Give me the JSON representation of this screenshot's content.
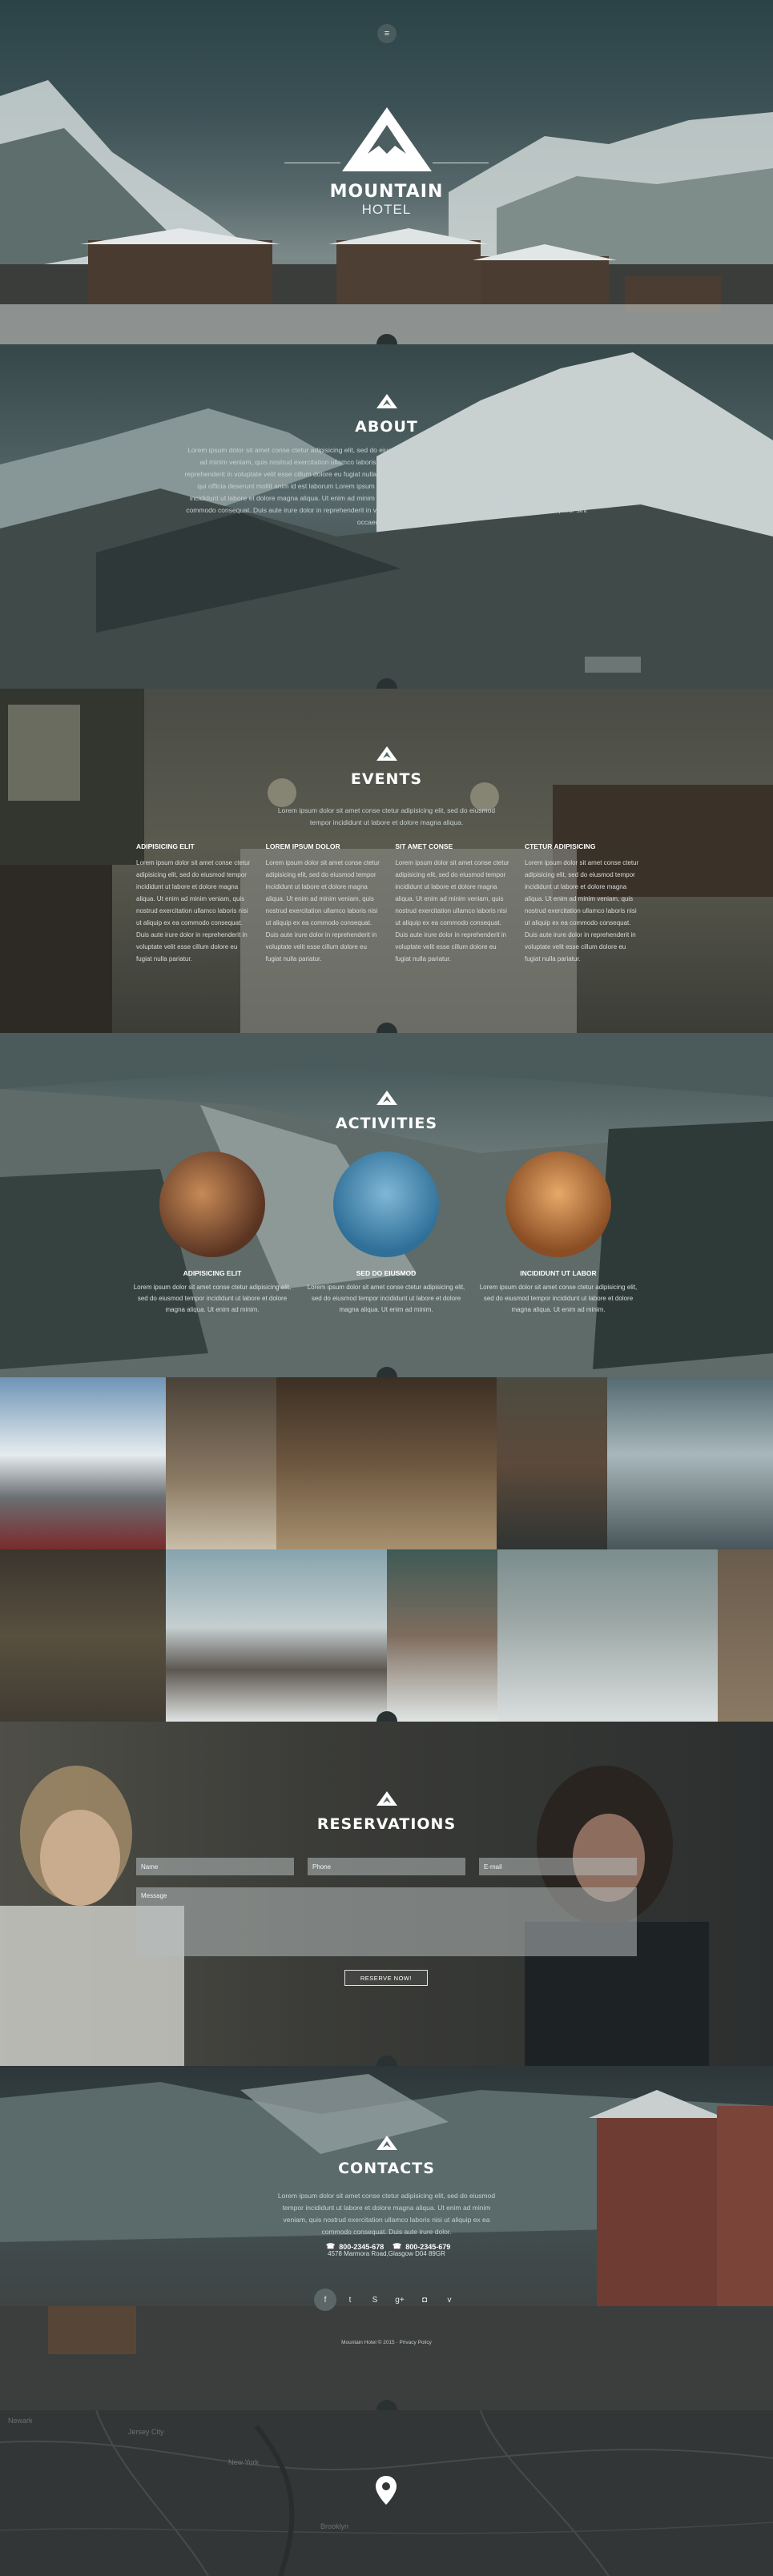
{
  "hero": {
    "title": "MOUNTAIN",
    "subtitle": "HOTEL",
    "menu_icon": "hamburger-icon"
  },
  "about": {
    "title": "ABOUT",
    "text": "Lorem ipsum dolor sit amet conse ctetur adipisicing elit, sed do eiusmod tempor incididunt ut labore et dolore magna aliqua. Ut enim ad minim veniam, quis nostrud exercitation ullamco laboris nisi ut aliquip ex ea commodo consequat. Duis aute irure dolor in reprehenderit in voluptate velit esse cillum dolore eu fugiat nulla pariatur. Excepteur sint occaecat cupidatat non proident, sunt in culpa qui officia deserunt mollit anim id est laborum Lorem ipsum dolor sit amet conse ctetur adipisicing elit, sed do eiusmod tempor incididunt ut labore et dolore magna aliqua. Ut enim ad minim veniam, quis nostrud exercitation ullamco laboris nisi ut aliquip ex ea commodo consequat. Duis aute irure dolor in reprehenderit in voluptate velit esse cillum dolore eu fugiat nulla pariatur. Excepteur sint occaecat cupidatat."
  },
  "events": {
    "title": "EVENTS",
    "intro": "Lorem ipsum dolor sit amet conse ctetur adipisicing elit, sed do eiusmod tempor incididunt ut labore et dolore magna aliqua.",
    "columns": [
      {
        "heading": "ADIPISICING ELIT",
        "text": "Lorem ipsum dolor sit amet conse ctetur adipisicing elit, sed do eiusmod tempor incididunt ut labore et dolore magna aliqua. Ut enim ad minim veniam, quis nostrud exercitation ullamco laboris nisi ut aliquip ex ea commodo consequat. Duis aute irure dolor in reprehenderit in voluptate velit esse cillum dolore eu fugiat nulla pariatur."
      },
      {
        "heading": "LOREM IPSUM DOLOR",
        "text": "Lorem ipsum dolor sit amet conse ctetur adipisicing elit, sed do eiusmod tempor incididunt ut labore et dolore magna aliqua. Ut enim ad minim veniam, quis nostrud exercitation ullamco laboris nisi ut aliquip ex ea commodo consequat. Duis aute irure dolor in reprehenderit in voluptate velit esse cillum dolore eu fugiat nulla pariatur."
      },
      {
        "heading": "SIT AMET CONSE",
        "text": "Lorem ipsum dolor sit amet conse ctetur adipisicing elit, sed do eiusmod tempor incididunt ut labore et dolore magna aliqua. Ut enim ad minim veniam, quis nostrud exercitation ullamco laboris nisi ut aliquip ex ea commodo consequat. Duis aute irure dolor in reprehenderit in voluptate velit esse cillum dolore eu fugiat nulla pariatur."
      },
      {
        "heading": "CTETUR ADIPISICING",
        "text": "Lorem ipsum dolor sit amet conse ctetur adipisicing elit, sed do eiusmod tempor incididunt ut labore et dolore magna aliqua. Ut enim ad minim veniam, quis nostrud exercitation ullamco laboris nisi ut aliquip ex ea commodo consequat. Duis aute irure dolor in reprehenderit in voluptate velit esse cillum dolore eu fugiat nulla pariatur."
      }
    ]
  },
  "activities": {
    "title": "ACTIVITIES",
    "items": [
      {
        "heading": "ADIPISICING ELIT",
        "text": "Lorem ipsum dolor sit amet conse ctetur adipisicing elit, sed do eiusmod tempor incididunt ut labore et dolore magna aliqua. Ut enim ad minim."
      },
      {
        "heading": "SED DO EIUSMOD",
        "text": "Lorem ipsum dolor sit amet conse ctetur adipisicing elit, sed do eiusmod tempor incididunt ut labore et dolore magna aliqua. Ut enim ad minim."
      },
      {
        "heading": "INCIDIDUNT UT LABOR",
        "text": "Lorem ipsum dolor sit amet conse ctetur adipisicing elit, sed do eiusmod tempor incididunt ut labore et dolore magna aliqua. Ut enim ad minim."
      }
    ]
  },
  "reservations": {
    "title": "RESERVATIONS",
    "name_placeholder": "Name",
    "phone_placeholder": "Phone",
    "email_placeholder": "E-mail",
    "message_placeholder": "Message",
    "button": "RESERVE NOW!"
  },
  "contacts": {
    "title": "CONTACTS",
    "text": "Lorem ipsum dolor sit amet conse ctetur adipisicing elit, sed do eiusmod tempor incididunt ut labore et dolore magna aliqua. Ut enim ad minim veniam, quis nostrud exercitation ullamco laboris nisi ut aliquip ex ea commodo consequat. Duis aute irure dolor.",
    "phone1": "800-2345-678",
    "phone2": "800-2345-679",
    "address": "4578 Marmora Road,Glasgow D04 89GR",
    "social": [
      "facebook-icon",
      "twitter-icon",
      "skype-icon",
      "google-plus-icon",
      "instagram-icon",
      "vimeo-icon"
    ],
    "footer": "Mountain Hotel © 2015 · Privacy Policy"
  },
  "map": {
    "labels": [
      "Newark",
      "Jersey City",
      "New York",
      "Brooklyn"
    ]
  },
  "colors": {
    "accent": "#ffffff",
    "dark": "#1f2426"
  }
}
